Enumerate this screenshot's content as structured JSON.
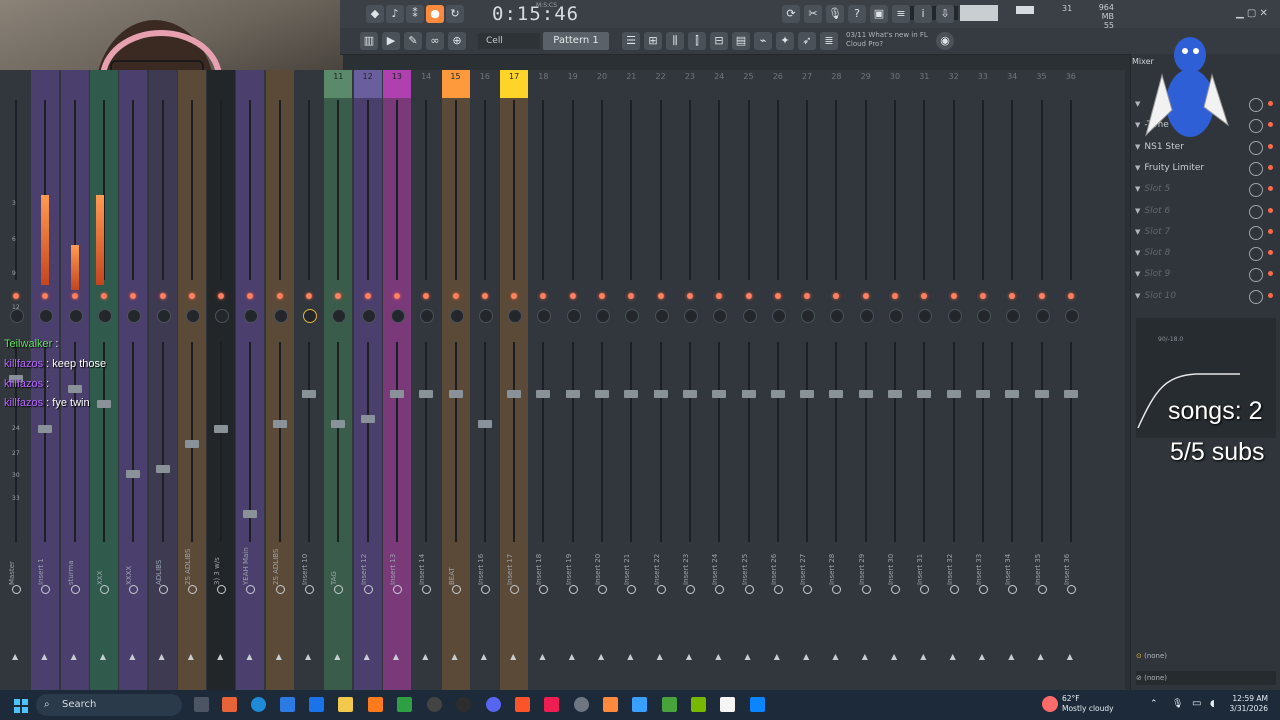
{
  "transport": {
    "time": "0:15:46",
    "time_label": "M:S:CS",
    "cpu": "31",
    "memory": "964 MB",
    "memory_extra": "55",
    "pattern": "Pattern 1",
    "snap": "Cell",
    "news_date": "03/11",
    "news_line1": "What's new in FL",
    "news_line2": "Cloud Pro?"
  },
  "mixer": {
    "title": "Mixer",
    "header_numbers": [
      "11",
      "12",
      "13",
      "14",
      "15",
      "16",
      "17",
      "18",
      "19",
      "20",
      "21",
      "22",
      "23",
      "24",
      "25",
      "26",
      "27",
      "28",
      "29",
      "30",
      "31",
      "32",
      "33",
      "34",
      "35",
      "36"
    ],
    "strip_names": [
      "Master",
      "Insert 1",
      "sturma",
      "XXX",
      "XXXX",
      "ADLIBS",
      "2S ADLIBS",
      "3) 3 w/s",
      "YEAH Main",
      "2S ADLIBS",
      "Insert 10",
      "TAG",
      "Insert 12",
      "Insert 13",
      "Insert 14",
      "BEAT",
      "Insert 16",
      "Insert 17",
      "Insert 18",
      "Insert 19",
      "Insert 20",
      "Insert 21",
      "Insert 22",
      "Insert 23",
      "Insert 24",
      "Insert 25",
      "Insert 26",
      "Insert 27",
      "Insert 28",
      "Insert 29",
      "Insert 30",
      "Insert 31",
      "Insert 32",
      "Insert 33",
      "Insert 34",
      "Insert 35",
      "Insert 36"
    ],
    "scale_numbers": [
      "3",
      "6",
      "9",
      "12",
      "24",
      "27",
      "30",
      "33"
    ]
  },
  "panel": {
    "slots": [
      {
        "label": "",
        "empty": false
      },
      {
        "label": "-Time",
        "empty": false
      },
      {
        "label": "NS1 Ster",
        "empty": false
      },
      {
        "label": "Fruity Limiter",
        "empty": false
      },
      {
        "label": "Slot 5",
        "empty": true
      },
      {
        "label": "Slot 6",
        "empty": true
      },
      {
        "label": "Slot 7",
        "empty": true
      },
      {
        "label": "Slot 8",
        "empty": true
      },
      {
        "label": "Slot 9",
        "empty": true
      },
      {
        "label": "Slot 10",
        "empty": true
      }
    ],
    "graph_label": "90/-18.0",
    "send_in": "(none)",
    "send_out": "(none)"
  },
  "overlay": {
    "songs": "songs: 2",
    "subs": "5/5 subs"
  },
  "chat": [
    {
      "user": "Teilwalker",
      "message": "",
      "green": true
    },
    {
      "user": "killfazos",
      "message": "keep those",
      "green": false
    },
    {
      "user": "killfazos",
      "message": "",
      "green": false
    },
    {
      "user": "killfazos",
      "message": "fye twin",
      "green": false
    }
  ],
  "taskbar": {
    "search": "Search",
    "temperature": "62°F",
    "weather": "Mostly cloudy",
    "time": "12:59 AM",
    "date": "3/31/2026"
  },
  "colors": {
    "accent": "#ff8a3d",
    "strip_purple": "#4b3f6e",
    "strip_green": "#3a5c4a",
    "strip_brown": "#5b4a37",
    "strip_magenta": "#7a3a7a"
  }
}
